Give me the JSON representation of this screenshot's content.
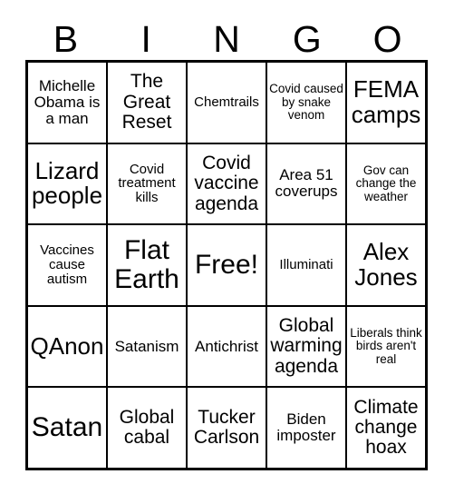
{
  "header": {
    "letters": [
      "B",
      "I",
      "N",
      "G",
      "O"
    ]
  },
  "grid": {
    "rows": [
      {
        "cells": [
          {
            "text": "Michelle Obama is a man",
            "size": "fs-sm"
          },
          {
            "text": "The Great Reset",
            "size": "fs-md"
          },
          {
            "text": "Chemtrails",
            "size": "fs-xs"
          },
          {
            "text": "Covid caused by snake venom",
            "size": "fs-xxs"
          },
          {
            "text": "FEMA camps",
            "size": "fs-lg"
          }
        ]
      },
      {
        "cells": [
          {
            "text": "Lizard people",
            "size": "fs-lg"
          },
          {
            "text": "Covid treatment kills",
            "size": "fs-xs"
          },
          {
            "text": "Covid vaccine agenda",
            "size": "fs-md"
          },
          {
            "text": "Area 51 coverups",
            "size": "fs-sm"
          },
          {
            "text": "Gov can change the weather",
            "size": "fs-xxs"
          }
        ]
      },
      {
        "cells": [
          {
            "text": "Vaccines cause autism",
            "size": "fs-xs"
          },
          {
            "text": "Flat Earth",
            "size": "fs-xl"
          },
          {
            "text": "Free!",
            "size": "fs-xl"
          },
          {
            "text": "Illuminati",
            "size": "fs-xs"
          },
          {
            "text": "Alex Jones",
            "size": "fs-lg"
          }
        ]
      },
      {
        "cells": [
          {
            "text": "QAnon",
            "size": "fs-lg"
          },
          {
            "text": "Satanism",
            "size": "fs-sm"
          },
          {
            "text": "Antichrist",
            "size": "fs-sm"
          },
          {
            "text": "Global warming agenda",
            "size": "fs-md"
          },
          {
            "text": "Liberals think birds aren't real",
            "size": "fs-xxs"
          }
        ]
      },
      {
        "cells": [
          {
            "text": "Satan",
            "size": "fs-xl"
          },
          {
            "text": "Global cabal",
            "size": "fs-md"
          },
          {
            "text": "Tucker Carlson",
            "size": "fs-md"
          },
          {
            "text": "Biden imposter",
            "size": "fs-sm"
          },
          {
            "text": "Climate change hoax",
            "size": "fs-md"
          }
        ]
      }
    ]
  }
}
